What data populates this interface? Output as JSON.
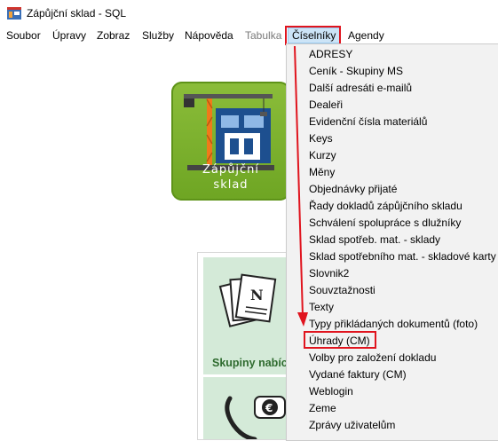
{
  "window": {
    "title": "Zápůjční sklad - SQL",
    "app_icon": "warehouse-icon"
  },
  "menubar": {
    "items": [
      {
        "label": "Soubor",
        "state": "normal"
      },
      {
        "label": "Úpravy",
        "state": "normal"
      },
      {
        "label": "Zobraz",
        "state": "normal"
      },
      {
        "label": "Služby",
        "state": "normal"
      },
      {
        "label": "Nápověda",
        "state": "normal"
      },
      {
        "label": "Tabulka",
        "state": "disabled"
      },
      {
        "label": "Číselníky",
        "state": "open"
      },
      {
        "label": "Agendy",
        "state": "normal"
      }
    ]
  },
  "logo": {
    "line1": "Zápůjční",
    "line2": "sklad"
  },
  "tiles": [
    {
      "label": "Skupiny nabíc",
      "icon": "documents-icon"
    },
    {
      "label": "",
      "icon": "phone-euro-icon"
    }
  ],
  "dropdown": {
    "items": [
      "ADRESY",
      "Ceník - Skupiny MS",
      "Další adresáti e-mailů",
      "Dealeři",
      "Evidenční čísla materiálů",
      "Keys",
      "Kurzy",
      "Měny",
      "Objednávky přijaté",
      "Řady dokladů zápůjčního skladu",
      "Schválení spolupráce s dlužníky",
      "Sklad spotřeb. mat. - sklady",
      "Sklad spotřebního mat. - skladové karty",
      "Slovnik2",
      "Souvztažnosti",
      "Texty",
      "Typy přikládaných dokumentů (foto)",
      "Úhrady (CM)",
      "Volby pro založení dokladu",
      "Vydané faktury (CM)",
      "Weblogin",
      "Zeme",
      "Zprávy uživatelům"
    ],
    "highlighted_item": "Úhrady (CM)"
  },
  "colors": {
    "annotation_red": "#e0141e",
    "menu_active_bg": "#cce4f7",
    "logo_green": "#7cb22d",
    "tile_green": "#d4ead8"
  }
}
